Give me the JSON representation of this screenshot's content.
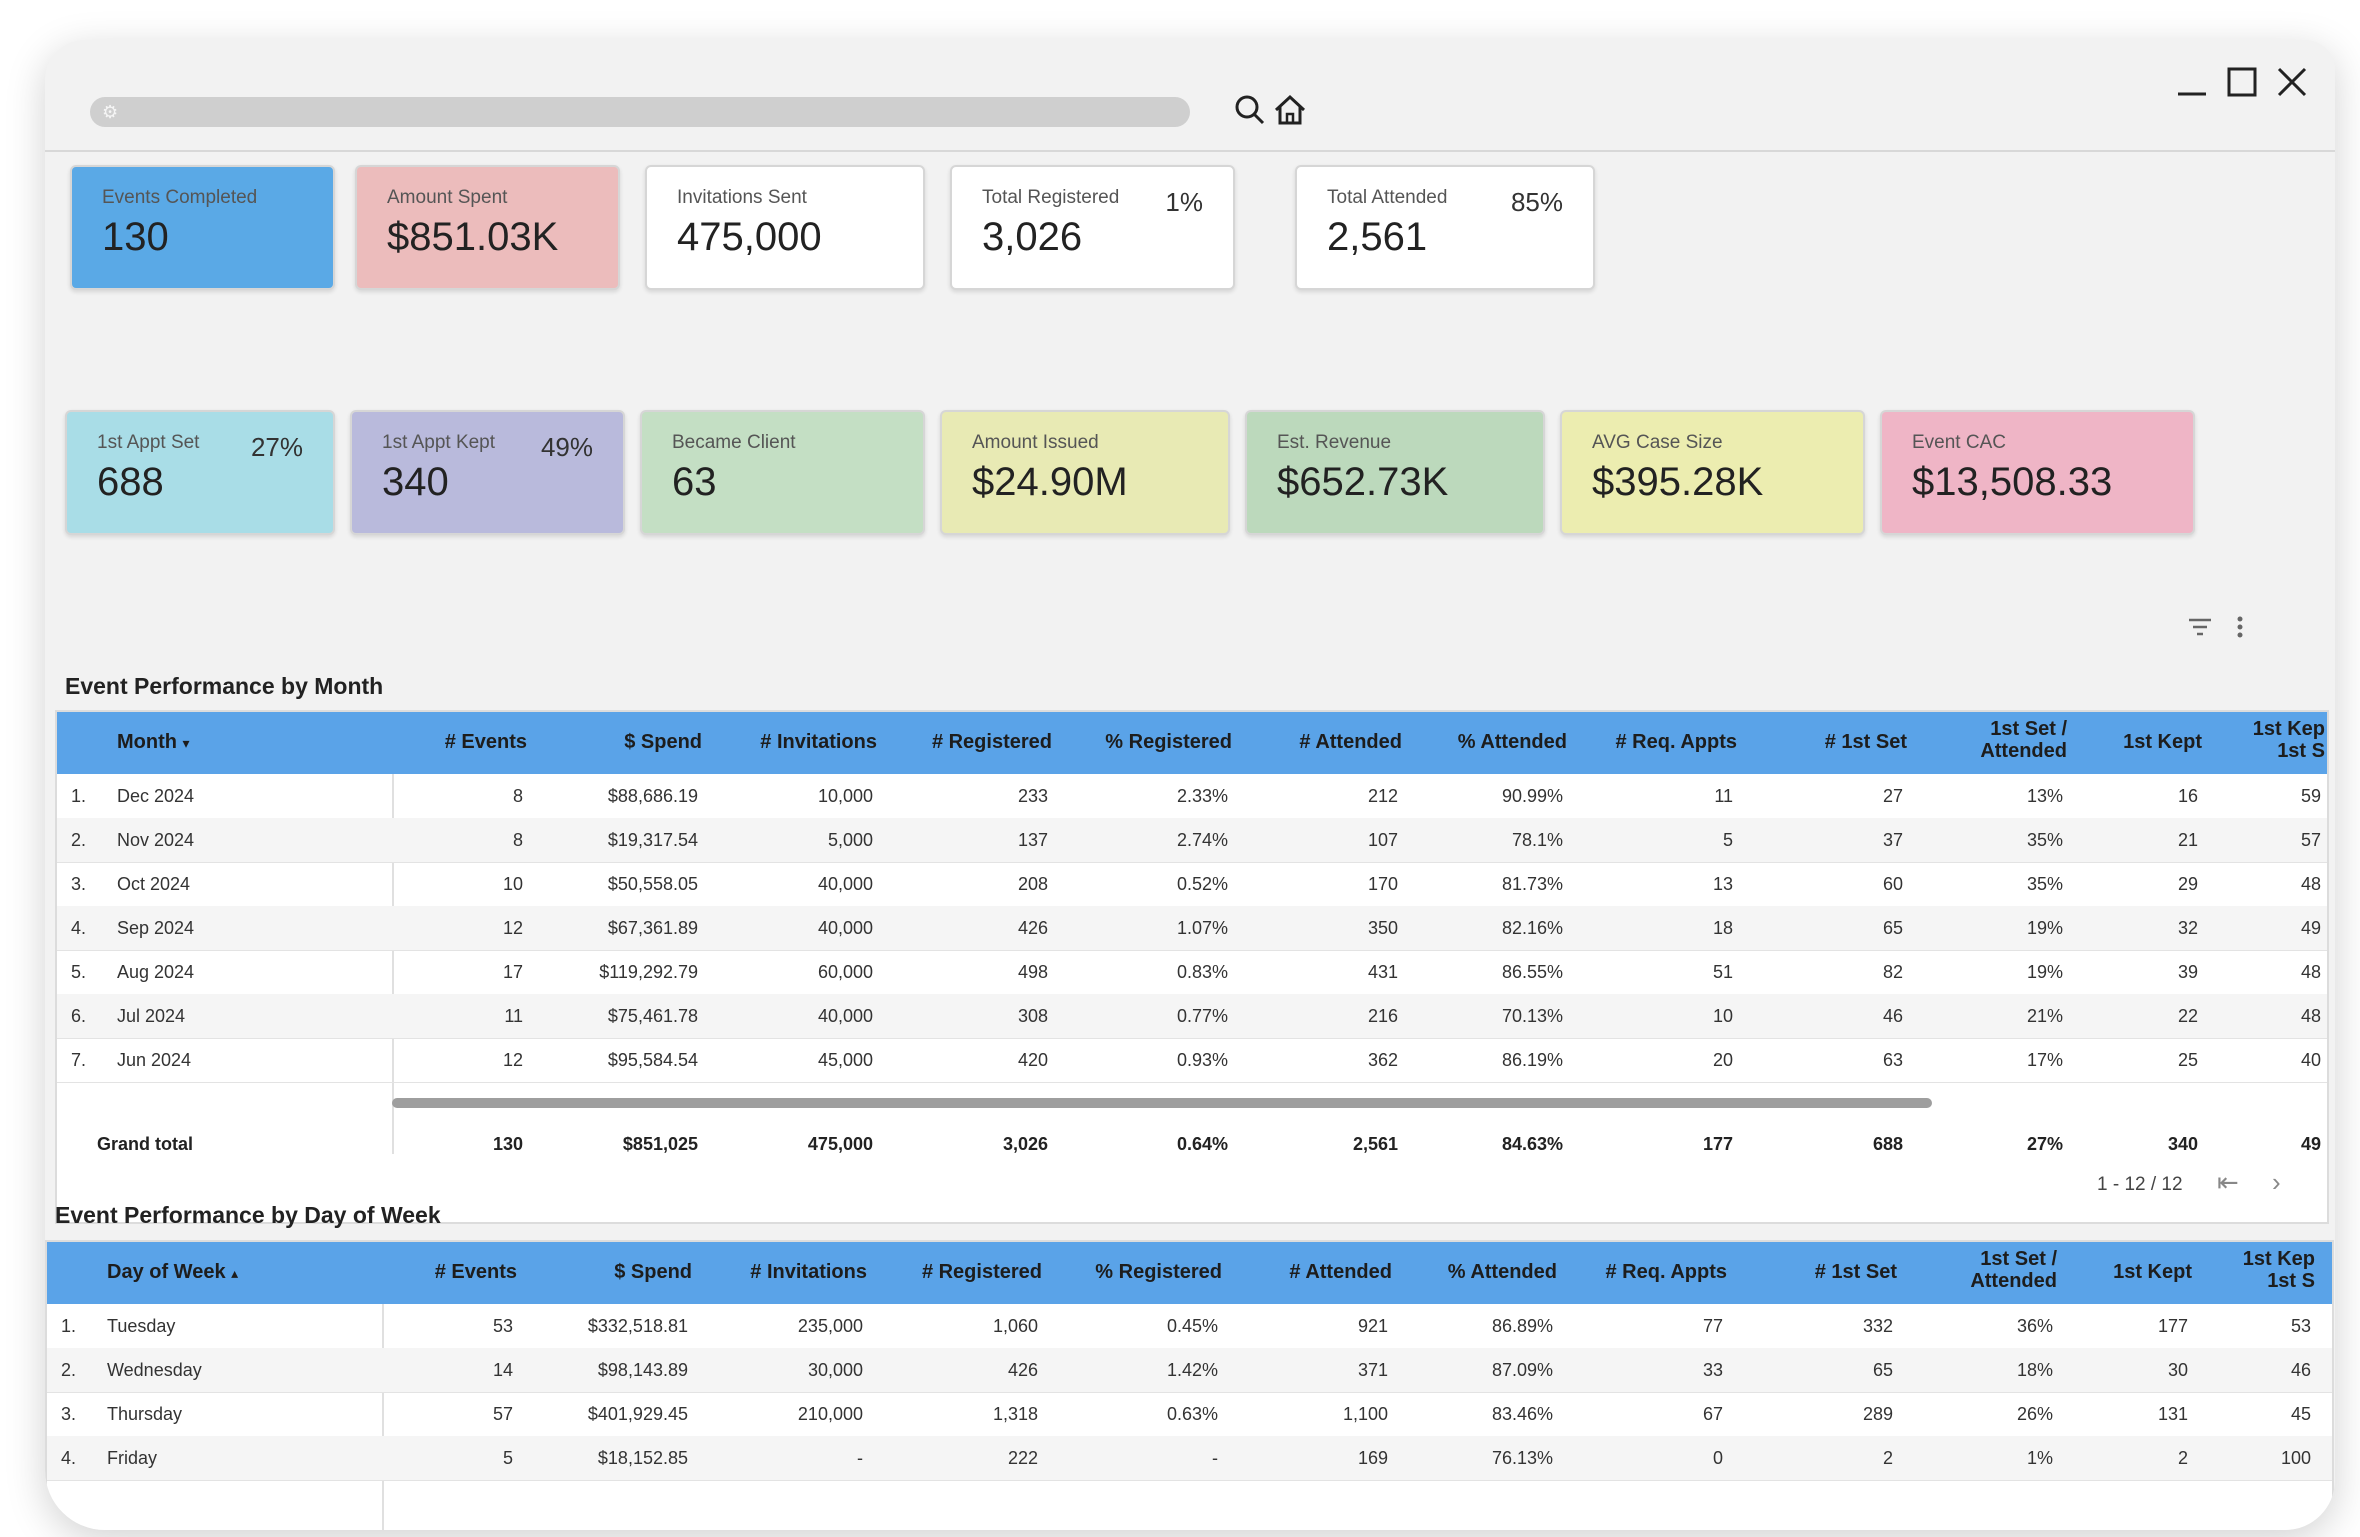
{
  "kpi_row1": [
    {
      "label": "Events Completed",
      "value": "130",
      "pct": "",
      "color": "#5aa9e6"
    },
    {
      "label": "Amount Spent",
      "value": "$851.03K",
      "pct": "",
      "color": "#ecbcbc"
    },
    {
      "label": "Invitations Sent",
      "value": "475,000",
      "pct": "",
      "color": "#ffffff"
    },
    {
      "label": "Total Registered",
      "value": "3,026",
      "pct": "1%",
      "color": "#ffffff"
    },
    {
      "label": "Total Attended",
      "value": "2,561",
      "pct": "85%",
      "color": "#ffffff"
    }
  ],
  "kpi_row2": [
    {
      "label": "1st Appt Set",
      "value": "688",
      "pct": "27%",
      "color": "#a9dde7"
    },
    {
      "label": "1st Appt Kept",
      "value": "340",
      "pct": "49%",
      "color": "#b9badc"
    },
    {
      "label": "Became Client",
      "value": "63",
      "pct": "",
      "color": "#c4dfc4"
    },
    {
      "label": "Amount Issued",
      "value": "$24.90M",
      "pct": "",
      "color": "#e8eab4"
    },
    {
      "label": "Est. Revenue",
      "value": "$652.73K",
      "pct": "",
      "color": "#bcd9bc"
    },
    {
      "label": "AVG Case Size",
      "value": "$395.28K",
      "pct": "",
      "color": "#ecedb0"
    },
    {
      "label": "Event CAC",
      "value": "$13,508.33",
      "pct": "",
      "color": "#efb5c6"
    }
  ],
  "month_table": {
    "title": "Event Performance by Month",
    "sort_label": "Month",
    "sort_glyph": "▾",
    "columns": [
      "# Events",
      "$ Spend",
      "# Invitations",
      "# Registered",
      "% Registered",
      "# Attended",
      "% Attended",
      "# Req. Appts",
      "# 1st Set",
      "1st Set /",
      "Attended",
      "1st Kept",
      "1st Kep",
      "1st S"
    ],
    "rows": [
      {
        "idx": "1.",
        "name": "Dec 2024",
        "v": [
          "8",
          "$88,686.19",
          "10,000",
          "233",
          "2.33%",
          "212",
          "90.99%",
          "11",
          "27",
          "13%",
          "16",
          "59"
        ]
      },
      {
        "idx": "2.",
        "name": "Nov 2024",
        "v": [
          "8",
          "$19,317.54",
          "5,000",
          "137",
          "2.74%",
          "107",
          "78.1%",
          "5",
          "37",
          "35%",
          "21",
          "57"
        ]
      },
      {
        "idx": "3.",
        "name": "Oct 2024",
        "v": [
          "10",
          "$50,558.05",
          "40,000",
          "208",
          "0.52%",
          "170",
          "81.73%",
          "13",
          "60",
          "35%",
          "29",
          "48"
        ]
      },
      {
        "idx": "4.",
        "name": "Sep 2024",
        "v": [
          "12",
          "$67,361.89",
          "40,000",
          "426",
          "1.07%",
          "350",
          "82.16%",
          "18",
          "65",
          "19%",
          "32",
          "49"
        ]
      },
      {
        "idx": "5.",
        "name": "Aug 2024",
        "v": [
          "17",
          "$119,292.79",
          "60,000",
          "498",
          "0.83%",
          "431",
          "86.55%",
          "51",
          "82",
          "19%",
          "39",
          "48"
        ]
      },
      {
        "idx": "6.",
        "name": "Jul 2024",
        "v": [
          "11",
          "$75,461.78",
          "40,000",
          "308",
          "0.77%",
          "216",
          "70.13%",
          "10",
          "46",
          "21%",
          "22",
          "48"
        ]
      },
      {
        "idx": "7.",
        "name": "Jun 2024",
        "v": [
          "12",
          "$95,584.54",
          "45,000",
          "420",
          "0.93%",
          "362",
          "86.19%",
          "20",
          "63",
          "17%",
          "25",
          "40"
        ]
      }
    ],
    "total": {
      "name": "Grand total",
      "v": [
        "130",
        "$851,025",
        "475,000",
        "3,026",
        "0.64%",
        "2,561",
        "84.63%",
        "177",
        "688",
        "27%",
        "340",
        "49"
      ]
    },
    "pager": "1 - 12 / 12"
  },
  "week_table": {
    "title": "Event Performance by Day of Week",
    "sort_label": "Day of Week",
    "sort_glyph": "▴",
    "columns": [
      "# Events",
      "$ Spend",
      "# Invitations",
      "# Registered",
      "% Registered",
      "# Attended",
      "% Attended",
      "# Req. Appts",
      "# 1st Set",
      "1st Set /",
      "Attended",
      "1st Kept",
      "1st Kep",
      "1st S"
    ],
    "rows": [
      {
        "idx": "1.",
        "name": "Tuesday",
        "v": [
          "53",
          "$332,518.81",
          "235,000",
          "1,060",
          "0.45%",
          "921",
          "86.89%",
          "77",
          "332",
          "36%",
          "177",
          "53"
        ]
      },
      {
        "idx": "2.",
        "name": "Wednesday",
        "v": [
          "14",
          "$98,143.89",
          "30,000",
          "426",
          "1.42%",
          "371",
          "87.09%",
          "33",
          "65",
          "18%",
          "30",
          "46"
        ]
      },
      {
        "idx": "3.",
        "name": "Thursday",
        "v": [
          "57",
          "$401,929.45",
          "210,000",
          "1,318",
          "0.63%",
          "1,100",
          "83.46%",
          "67",
          "289",
          "26%",
          "131",
          "45"
        ]
      },
      {
        "idx": "4.",
        "name": "Friday",
        "v": [
          "5",
          "$18,152.85",
          "-",
          "222",
          "-",
          "169",
          "76.13%",
          "0",
          "2",
          "1%",
          "2",
          "100"
        ]
      }
    ]
  }
}
